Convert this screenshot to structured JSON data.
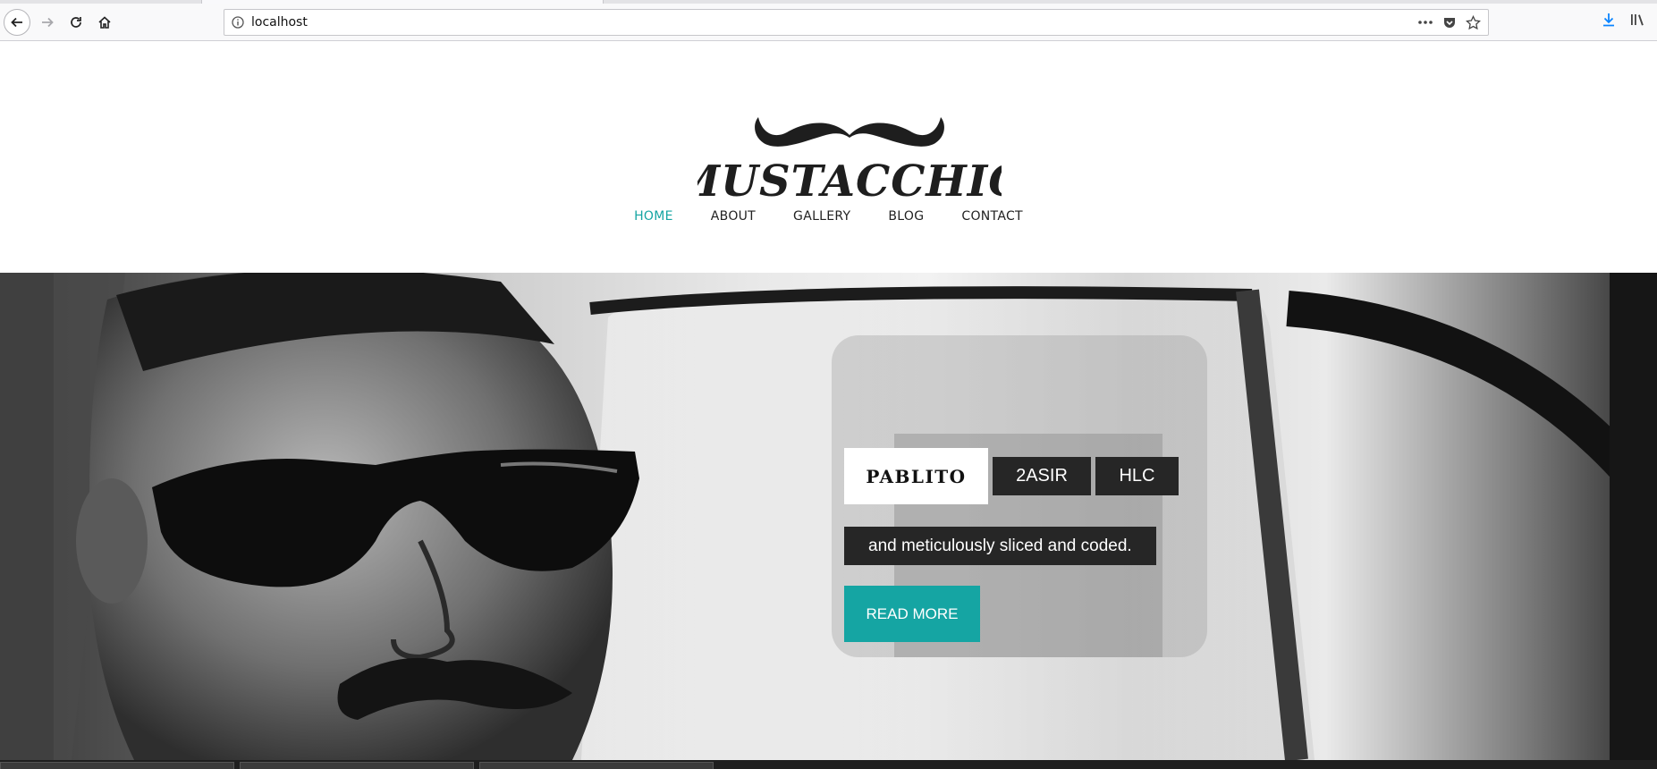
{
  "browser": {
    "url": "localhost",
    "icons": {
      "back": "arrow-left-icon",
      "forward": "arrow-right-icon",
      "reload": "reload-icon",
      "home": "home-icon",
      "info": "info-icon",
      "page_actions": "more-horizontal-icon",
      "pocket": "pocket-icon",
      "bookmark": "star-icon",
      "downloads": "download-icon",
      "library": "library-icon"
    }
  },
  "site": {
    "logo_text": "MUSTACCHIO",
    "nav": [
      {
        "label": "HOME",
        "active": true
      },
      {
        "label": "ABOUT",
        "active": false
      },
      {
        "label": "GALLERY",
        "active": false
      },
      {
        "label": "BLOG",
        "active": false
      },
      {
        "label": "CONTACT",
        "active": false
      }
    ],
    "hero": {
      "tags": [
        "PABLITO",
        "2ASIR",
        "HLC"
      ],
      "tagline": "and meticulously sliced and coded.",
      "cta_label": "READ MORE"
    },
    "colors": {
      "accent": "#15a5a3",
      "dark_label": "#262626"
    }
  }
}
